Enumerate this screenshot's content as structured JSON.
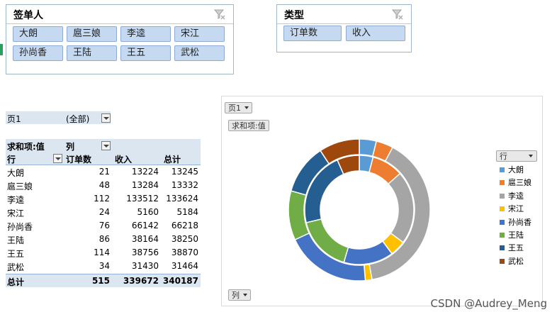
{
  "slicers": [
    {
      "id": "signer",
      "title": "签单人",
      "items": [
        "大朗",
        "扈三娘",
        "李逵",
        "宋江",
        "孙尚香",
        "王陆",
        "王五",
        "武松"
      ]
    },
    {
      "id": "type",
      "title": "类型",
      "items": [
        "订单数",
        "收入"
      ]
    }
  ],
  "pivot": {
    "page_filter": {
      "label": "页1",
      "value": "(全部)"
    },
    "values_label": "求和项:值",
    "col_label": "列",
    "row_label": "行",
    "columns": [
      "订单数",
      "收入",
      "总计"
    ],
    "rows": [
      {
        "name": "大朗",
        "orders": "21",
        "income": "13224",
        "total": "13245"
      },
      {
        "name": "扈三娘",
        "orders": "48",
        "income": "13284",
        "total": "13332"
      },
      {
        "name": "李逵",
        "orders": "112",
        "income": "133512",
        "total": "133624"
      },
      {
        "name": "宋江",
        "orders": "24",
        "income": "5160",
        "total": "5184"
      },
      {
        "name": "孙尚香",
        "orders": "76",
        "income": "66142",
        "total": "66218"
      },
      {
        "name": "王陆",
        "orders": "86",
        "income": "38164",
        "total": "38250"
      },
      {
        "name": "王五",
        "orders": "114",
        "income": "38756",
        "total": "38870"
      },
      {
        "name": "武松",
        "orders": "34",
        "income": "31430",
        "total": "31464"
      }
    ],
    "grand_total": {
      "name": "总计",
      "orders": "515",
      "income": "339672",
      "total": "340187"
    }
  },
  "chart": {
    "page_button": "页1",
    "values_button": "求和项:值",
    "legend_button": "行",
    "axis_button": "列"
  },
  "chart_data": {
    "type": "pie",
    "subtype": "doughnut",
    "legend_placement": "right",
    "categories": [
      "大朗",
      "扈三娘",
      "李逵",
      "宋江",
      "孙尚香",
      "王陆",
      "王五",
      "武松"
    ],
    "colors": [
      "#5b9bd5",
      "#ed7d31",
      "#a5a5a5",
      "#ffc000",
      "#4472c4",
      "#70ad47",
      "#255e91",
      "#9e480e"
    ],
    "series": [
      {
        "values": [
          21,
          48,
          112,
          24,
          76,
          86,
          114,
          34
        ]
      },
      {
        "values": [
          13224,
          13284,
          133512,
          5160,
          66142,
          38164,
          38756,
          31430
        ]
      }
    ]
  },
  "watermark": "CSDN @Audrey_Meng"
}
